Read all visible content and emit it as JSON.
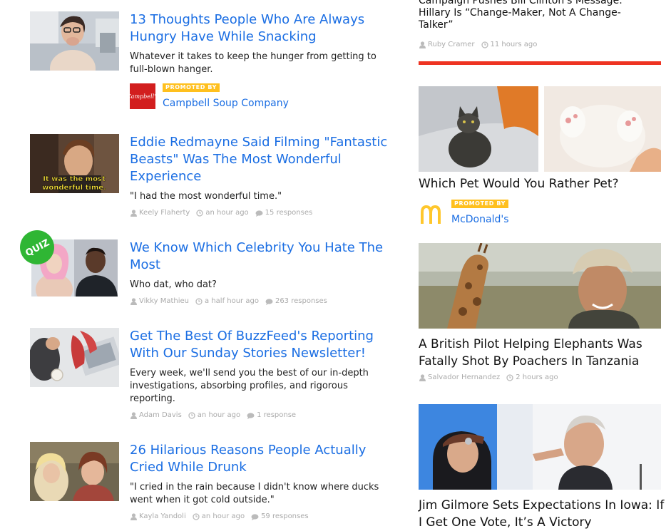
{
  "left_feed": [
    {
      "headline": "13 Thoughts People Who Are Always Hungry Have While Snacking",
      "description": "Whatever it takes to keep the hunger from getting to full-blown hanger.",
      "promoted": {
        "badge": "PROMOTED BY",
        "sponsor": "Campbell Soup Company",
        "logo_text": "Campbell's"
      }
    },
    {
      "headline": "Eddie Redmayne Said Filming \"Fantastic Beasts\" Was The Most Wonderful Experience",
      "description": "\"I had the most wonderful time.\"",
      "thumb_caption": "It was the most wonderful time.",
      "author": "Keely Flaherty",
      "time": "an hour ago",
      "responses": "15 responses"
    },
    {
      "headline": "We Know Which Celebrity You Hate The Most",
      "description": "Who dat, who dat?",
      "badge": "QUIZ",
      "author": "Vikky Mathieu",
      "time": "a half hour ago",
      "responses": "263 responses"
    },
    {
      "headline": "Get The Best Of BuzzFeed's Reporting With Our Sunday Stories Newsletter!",
      "description": "Every week, we'll send you the best of our in-depth investigations, absorbing profiles, and rigorous reporting.",
      "author": "Adam Davis",
      "time": "an hour ago",
      "responses": "1 response"
    },
    {
      "headline": "26 Hilarious Reasons People Actually Cried While Drunk",
      "description": "\"I cried in the rain because I didn't know where ducks went when it got cold outside.\"",
      "author": "Kayla Yandoli",
      "time": "an hour ago",
      "responses": "59 responses"
    }
  ],
  "right_feed": {
    "top_story": {
      "headline": "Campaign Pushes Bill Clinton's Message: Hillary Is “Change-Maker, Not A Change-Talker”",
      "author": "Ruby Cramer",
      "time": "11 hours ago"
    },
    "divider_color": "#ee3322",
    "pet": {
      "headline": "Which Pet Would You Rather Pet?",
      "promoted": {
        "badge": "PROMOTED BY",
        "sponsor": "McDonald's"
      }
    },
    "pilot": {
      "headline": "A British Pilot Helping Elephants Was Fatally Shot By Poachers In Tanzania",
      "author": "Salvador Hernandez",
      "time": "2 hours ago"
    },
    "gilmore": {
      "headline": "Jim Gilmore Sets Expectations In Iowa: If I Get One Vote, It’s A Victory"
    }
  },
  "colors": {
    "link": "#1b6ee3",
    "promo": "#ffc01e",
    "quiz": "#2fb634",
    "campbell": "#d21e1e",
    "mcd": "#ffc72c"
  }
}
